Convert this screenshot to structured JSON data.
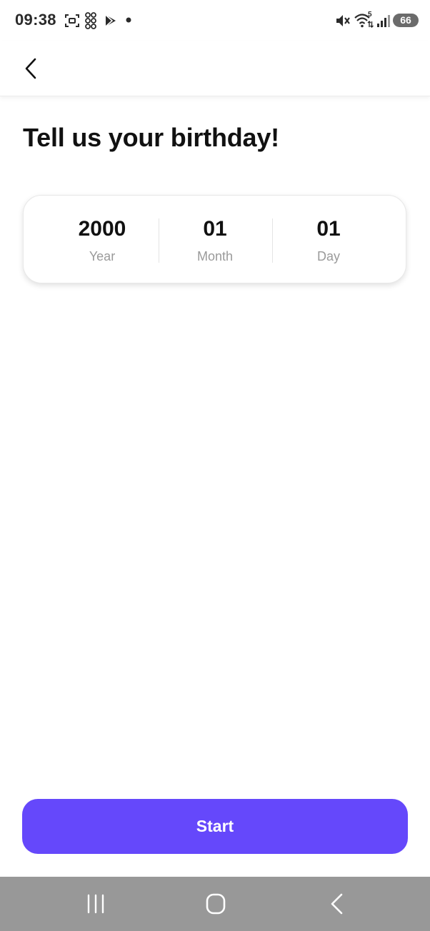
{
  "status_bar": {
    "time": "09:38",
    "battery": "66",
    "signal_label": "5",
    "icons": [
      "screenshot-icon",
      "qr-icon",
      "play-store-icon",
      "notification-dot-icon",
      "mute-icon",
      "wifi-icon",
      "signal-icon",
      "battery-icon"
    ]
  },
  "app_bar": {
    "back_icon": "chevron-left-icon"
  },
  "page": {
    "title": "Tell us your birthday!"
  },
  "date_picker": {
    "year": {
      "value": "2000",
      "label": "Year"
    },
    "month": {
      "value": "01",
      "label": "Month"
    },
    "day": {
      "value": "01",
      "label": "Day"
    }
  },
  "start_button": {
    "label": "Start"
  },
  "nav_bar": {
    "icons": [
      "recents-icon",
      "home-icon",
      "back-icon"
    ]
  },
  "colors": {
    "accent": "#6548fb",
    "label_gray": "#9a9a9a",
    "nav_bar": "#989898"
  }
}
